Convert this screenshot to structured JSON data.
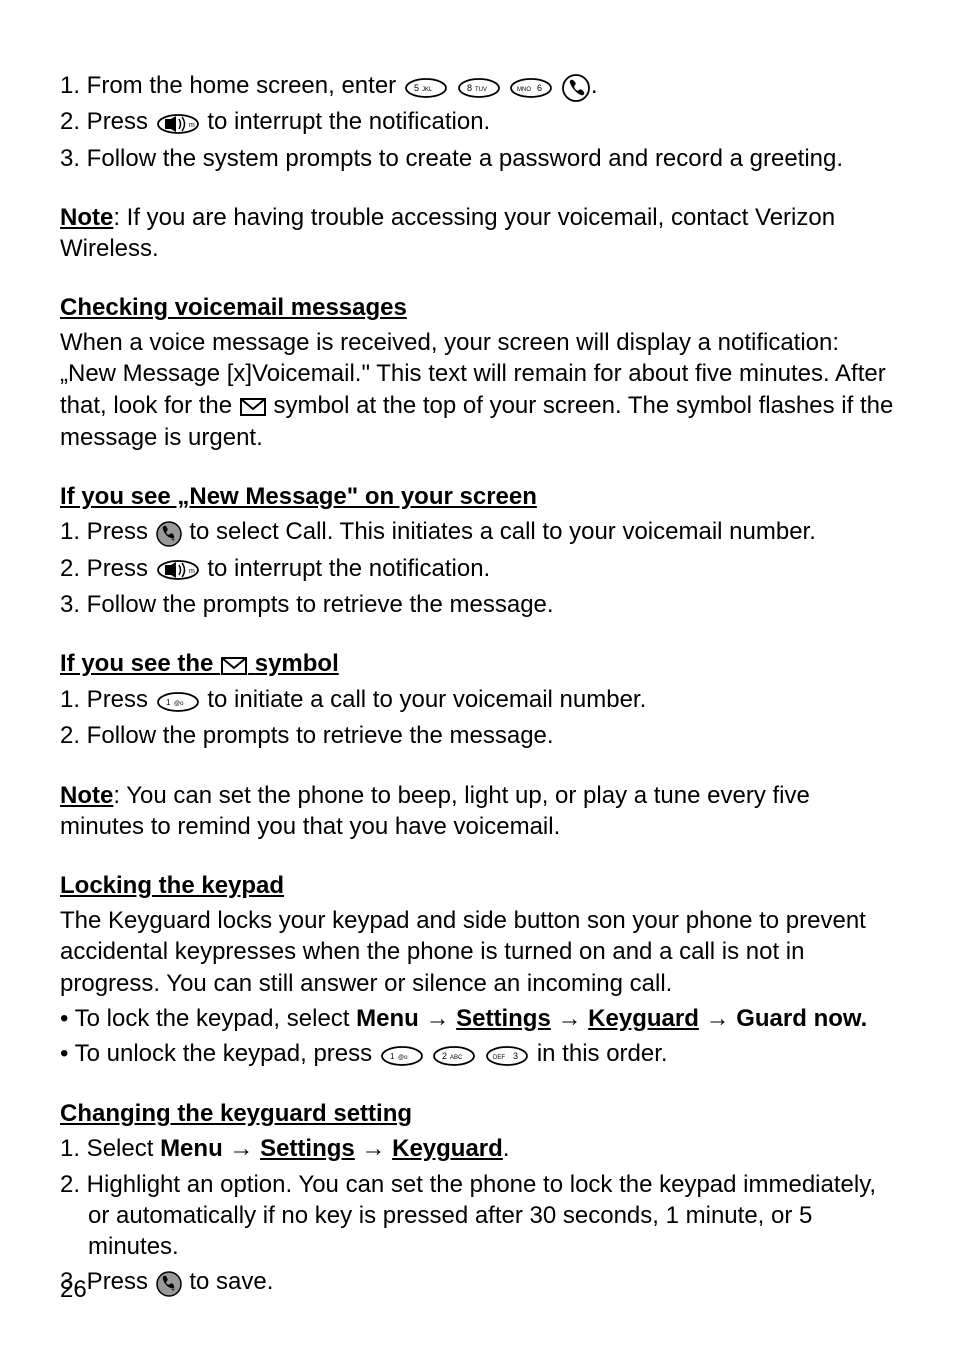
{
  "s1": {
    "l1a": "1. From the home screen, enter ",
    "l1b": ".",
    "l2a": "2. Press ",
    "l2b": "to interrupt the notification.",
    "l3": "3. Follow the system prompts to create a password and record a greeting."
  },
  "note1": {
    "label": "Note",
    "text": ": If you are having trouble accessing your voicemail, contact Verizon Wireless."
  },
  "checking": {
    "heading": "Checking voicemail messages",
    "p1a": "When a voice message is received, your screen will display a notification: „New Message [x]Voicemail.\" This text will remain for about five minutes. After that, look for the ",
    "p1b": " symbol at the top of your screen. The symbol flashes if the message is urgent."
  },
  "newmsg": {
    "heading": "If you see „New Message\" on your screen",
    "l1a": "1. Press ",
    "l1b": "to select Call. This initiates a call to your voicemail number.",
    "l2a": "2. Press ",
    "l2b": "to interrupt the notification.",
    "l3": "3. Follow the prompts to retrieve the message."
  },
  "symbol": {
    "heading_a": "If you see the ",
    "heading_b": " symbol",
    "l1a": "1. Press ",
    "l1b": " to initiate a call to your voicemail number.",
    "l2": "2. Follow the prompts to retrieve the message."
  },
  "note2": {
    "label": "Note",
    "text": ": You can set the phone to beep, light up, or play a tune every five minutes to remind you that you have voicemail."
  },
  "locking": {
    "heading": "Locking the keypad",
    "p1": "The Keyguard locks your keypad and side button son your phone to prevent accidental keypresses when the phone is turned on and a call is not in progress. You can still answer or silence an incoming call.",
    "bullet1a": "• To lock the keypad, select ",
    "menu": "Menu",
    "arrow": " → ",
    "settings": "Settings",
    "keyguard": "Keyguard",
    "guardnow": "Guard now.",
    "bullet2a": "• To unlock the keypad, press ",
    "bullet2b": " in this order."
  },
  "changing": {
    "heading": "Changing the keyguard setting",
    "l1a": "1. Select ",
    "menu": "Menu",
    "arrow": " → ",
    "settings": "Settings",
    "keyguard": "Keyguard",
    "period": ".",
    "l2": "2. Highlight an option. You can set the phone to lock the keypad immediately, or automatically if no key is pressed after 30 seconds, 1 minute, or 5 minutes.",
    "l3a": "3. Press ",
    "l3b": "to save."
  },
  "pagenum": "26",
  "icons": {
    "key_5": "5JKL",
    "key_8": "8TUV",
    "key_6": "MNO6",
    "key_1": "1@o",
    "key_2": "2ABC",
    "key_3": "DEF3"
  }
}
